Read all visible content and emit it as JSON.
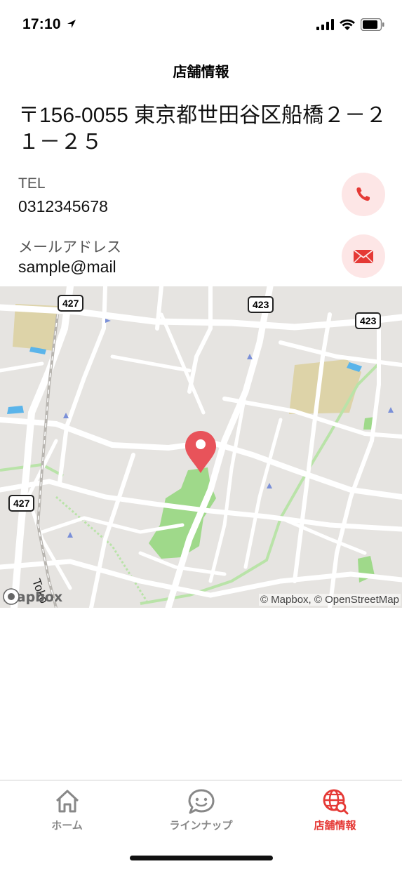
{
  "status_bar": {
    "time": "17:10",
    "icons": [
      "location-arrow-icon",
      "signal-icon",
      "wifi-icon",
      "battery-icon"
    ]
  },
  "header": {
    "title": "店舗情報"
  },
  "store": {
    "address": "〒156-0055 東京都世田谷区船橋２－２１－２５",
    "tel_label": "TEL",
    "tel_value": "0312345678",
    "email_label": "メールアドレス",
    "email_value": "sample@mail"
  },
  "map": {
    "logo_text": "mapbox",
    "attribution": "© Mapbox, © OpenStreetMap",
    "route_badges": [
      "427",
      "423",
      "423",
      "427"
    ],
    "street_label": "Toko",
    "colors": {
      "marker": "#e8535a",
      "park": "#9fd98a",
      "school": "#ddd3a8",
      "road": "#ffffff",
      "land": "#e6e4e1"
    }
  },
  "tabs": [
    {
      "label": "ホーム",
      "icon": "home-icon",
      "active": false
    },
    {
      "label": "ラインナップ",
      "icon": "chat-smile-icon",
      "active": false
    },
    {
      "label": "店舗情報",
      "icon": "globe-search-icon",
      "active": true
    }
  ],
  "accent_color": "#e53935"
}
